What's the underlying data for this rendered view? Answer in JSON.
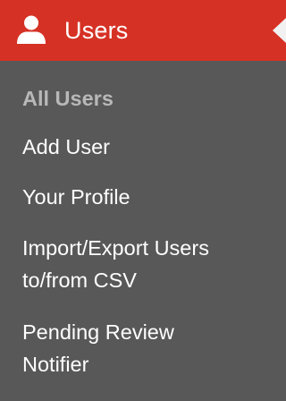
{
  "menu": {
    "title": "Users",
    "icon": "user-icon",
    "header_color": "#d63125",
    "items": [
      {
        "label": "All Users",
        "current": true
      },
      {
        "label": "Add User",
        "current": false
      },
      {
        "label": "Your Profile",
        "current": false
      },
      {
        "line1": "Import/Export Users",
        "line2": "to/from CSV",
        "current": false
      },
      {
        "line1": "Pending Review",
        "line2": "Notifier",
        "current": false
      }
    ]
  }
}
